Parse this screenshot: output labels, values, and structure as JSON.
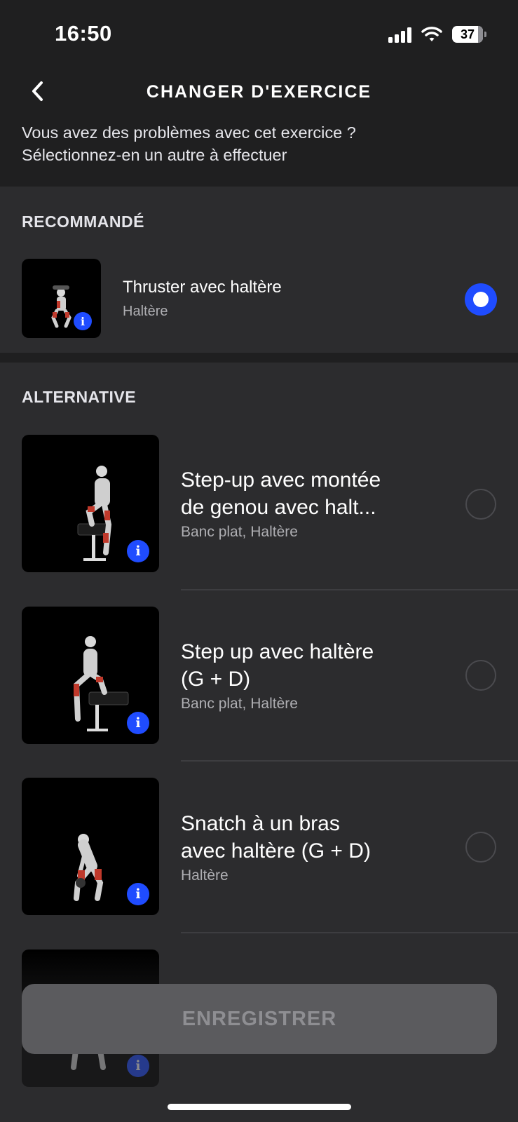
{
  "status_bar": {
    "time": "16:50",
    "battery": "37"
  },
  "header": {
    "title": "CHANGER D'EXERCICE",
    "subtitle_line1": "Vous avez des problèmes avec cet exercice ?",
    "subtitle_line2": "Sélectionnez-en un autre à effectuer"
  },
  "recommended": {
    "label": "RECOMMANDÉ",
    "item": {
      "title": "Thruster avec haltère",
      "subtitle": "Haltère",
      "selected": true
    }
  },
  "alternative": {
    "label": "ALTERNATIVE",
    "items": [
      {
        "title_line1": "Step-up avec montée",
        "title_line2": "de genou avec halt...",
        "subtitle": "Banc plat, Haltère",
        "selected": false
      },
      {
        "title_line1": "Step up avec haltère",
        "title_line2": "(G + D)",
        "subtitle": "Banc plat, Haltère",
        "selected": false
      },
      {
        "title_line1": "Snatch à un bras",
        "title_line2": "avec haltère (G + D)",
        "subtitle": "Haltère",
        "selected": false
      }
    ]
  },
  "save_button": {
    "label": "ENREGISTRER"
  },
  "colors": {
    "accent": "#1f4cff",
    "background": "#2c2c2e",
    "header": "#1f1f20"
  }
}
